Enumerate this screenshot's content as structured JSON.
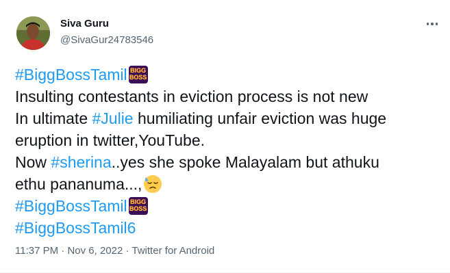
{
  "author": {
    "name": "Siva Guru",
    "handle": "@SivaGur24783546"
  },
  "tweet": {
    "line1_tag": "#BiggBossTamil",
    "line2": "Insulting contestants in eviction process is not new",
    "line3_pre": "In ultimate ",
    "line3_tag": "#Julie",
    "line3_post": " humiliating unfair eviction was huge",
    "line4": "eruption in twitter,YouTube.",
    "line5_pre": "Now ",
    "line5_tag": "#sherina",
    "line5_post": "..yes she spoke Malayalam but athuku",
    "line6": "ethu pananuma...,",
    "line7_tag": "#BiggBossTamil",
    "line8_tag": "#BiggBossTamil6",
    "hashflag_text_top": "BIGG",
    "hashflag_text_bottom": "BOSS",
    "emoji": "downcast-face-with-sweat"
  },
  "meta": {
    "time": "11:37 PM",
    "sep1": " · ",
    "date": "Nov 6, 2022",
    "sep2": " · ",
    "source": "Twitter for Android"
  },
  "colors": {
    "link": "#1d9bf0",
    "text": "#0f1419",
    "secondary": "#536471"
  },
  "icons": {
    "more": "more-horizontal-icon"
  }
}
